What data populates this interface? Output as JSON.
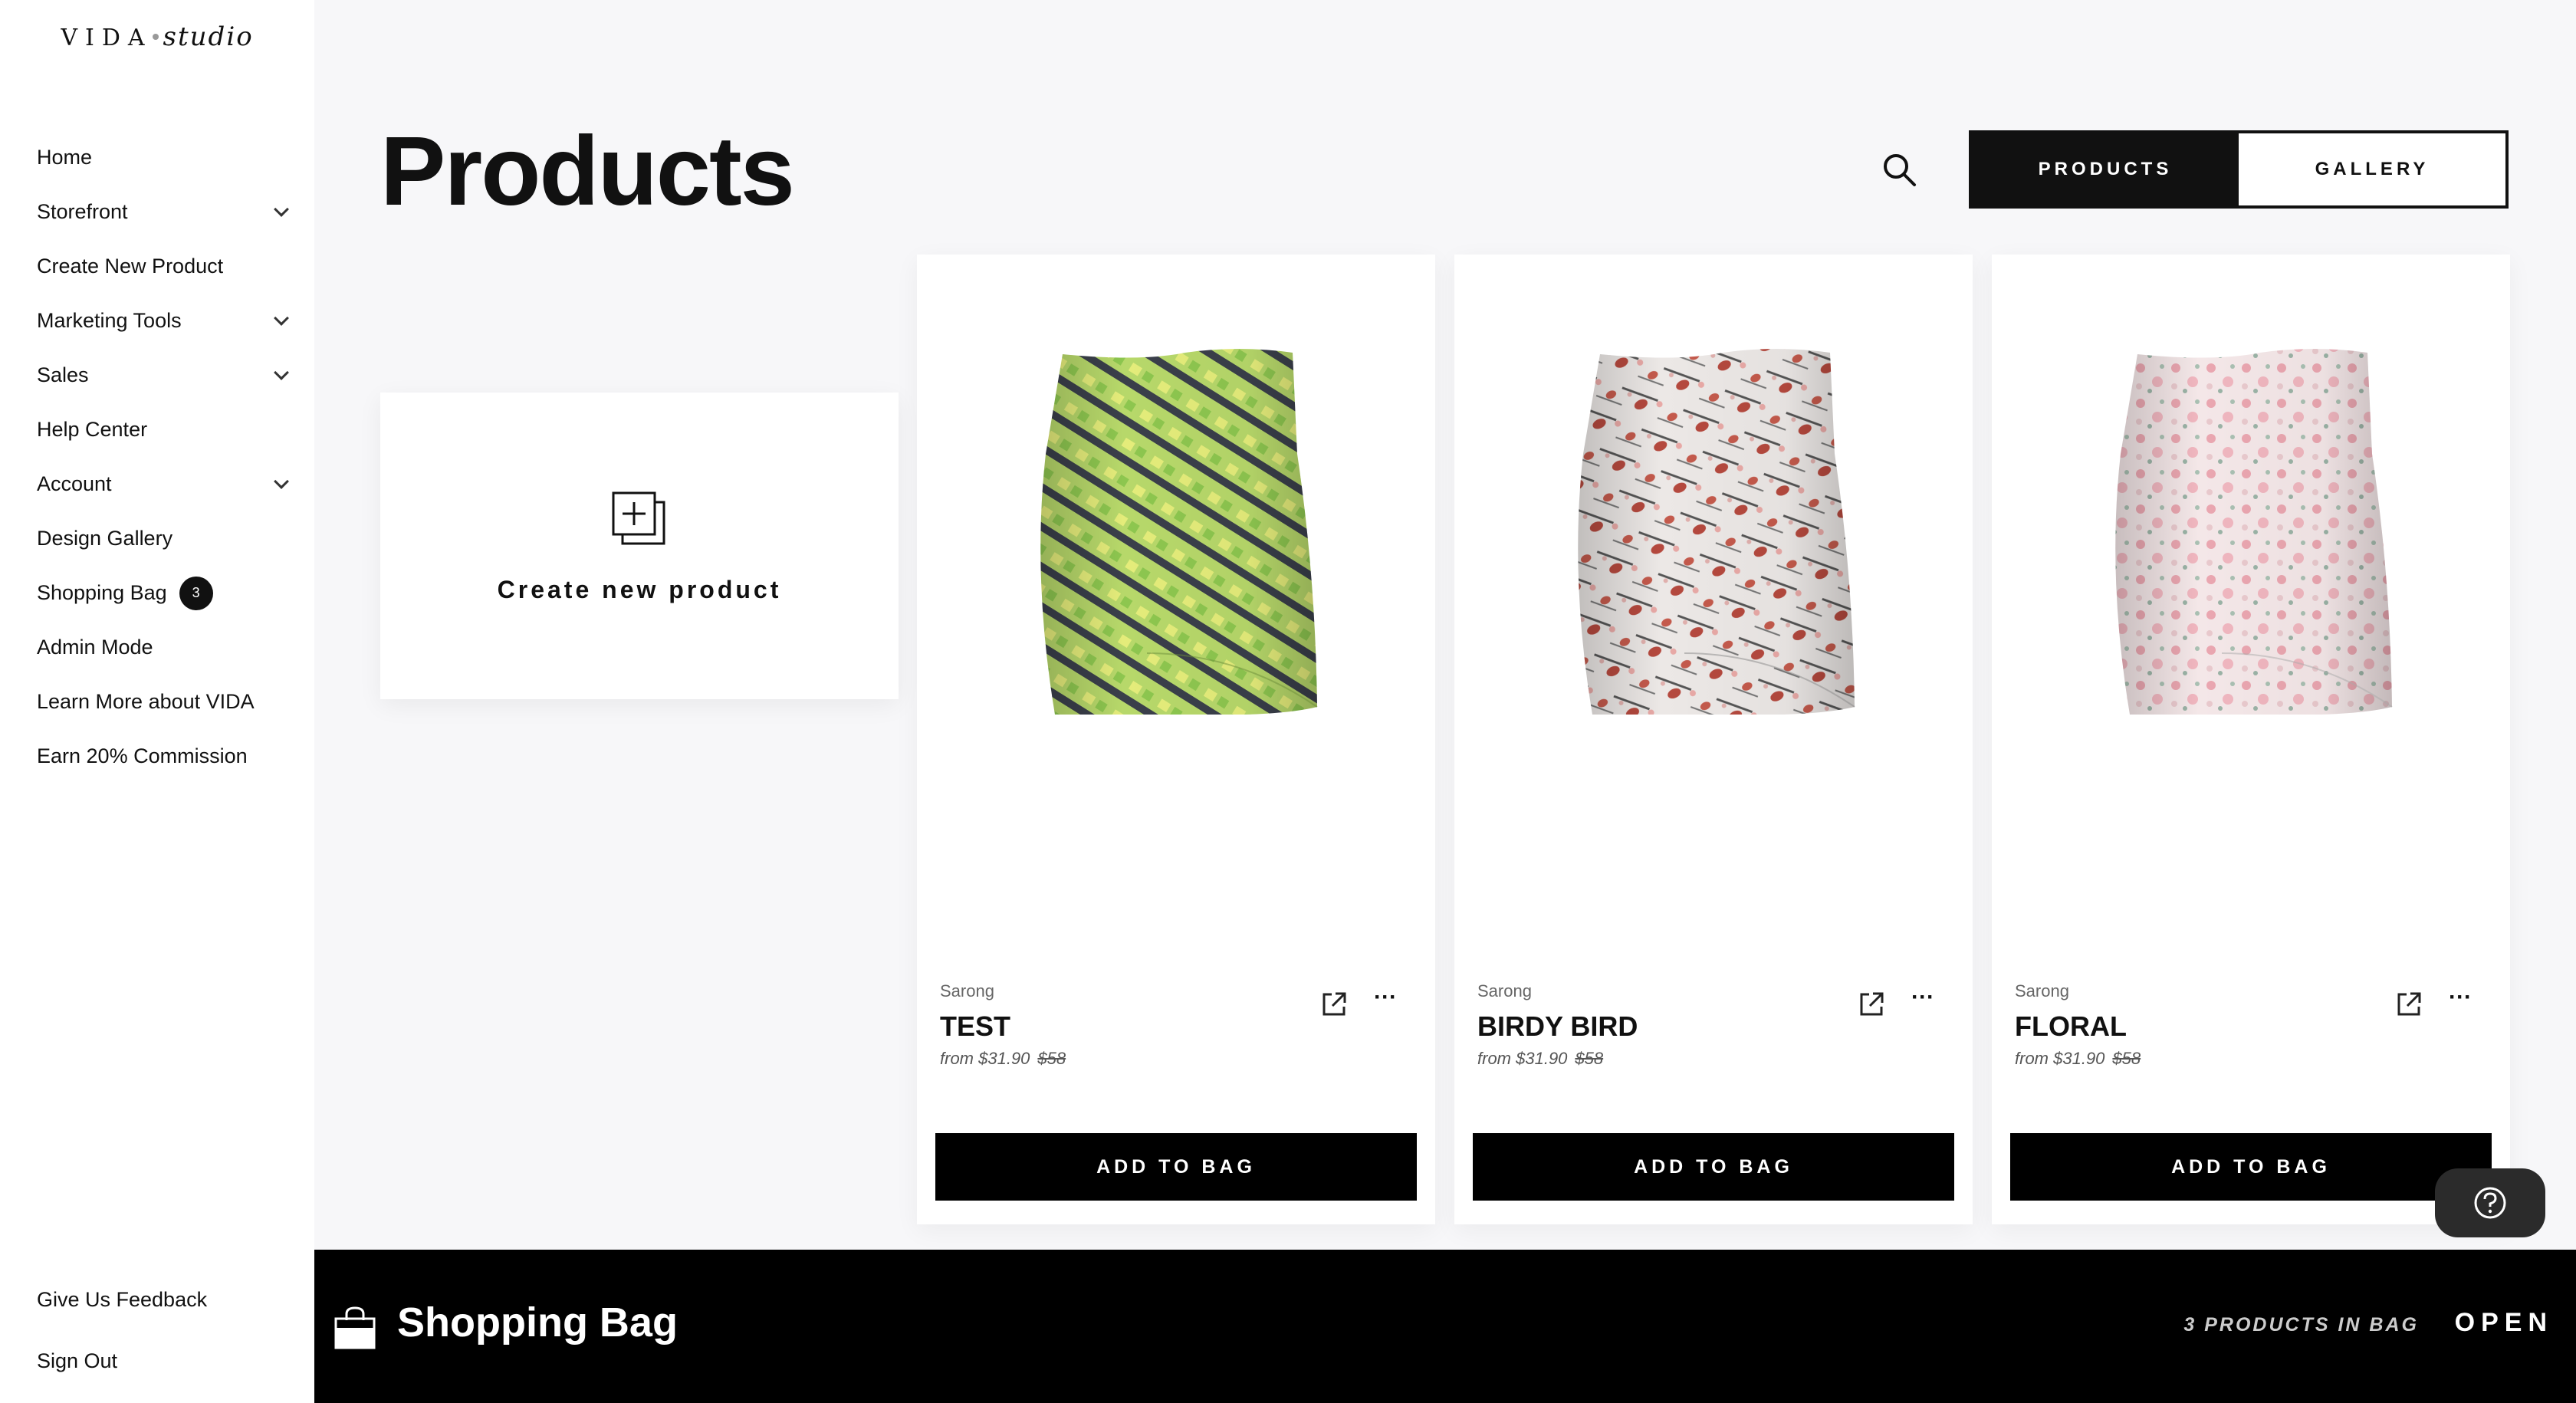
{
  "brand": {
    "left": "VIDA",
    "right": "studio"
  },
  "sidebar": {
    "items": [
      {
        "label": "Home",
        "expandable": false
      },
      {
        "label": "Storefront",
        "expandable": true
      },
      {
        "label": "Create New Product",
        "expandable": false
      },
      {
        "label": "Marketing Tools",
        "expandable": true
      },
      {
        "label": "Sales",
        "expandable": true
      },
      {
        "label": "Help Center",
        "expandable": false
      },
      {
        "label": "Account",
        "expandable": true
      },
      {
        "label": "Design Gallery",
        "expandable": false
      },
      {
        "label": "Shopping Bag",
        "badge": "3"
      },
      {
        "label": "Admin Mode",
        "expandable": false
      },
      {
        "label": "Learn More about VIDA",
        "expandable": false
      },
      {
        "label": "Earn 20% Commission",
        "expandable": false
      }
    ],
    "bottom": [
      {
        "label": "Give Us Feedback"
      },
      {
        "label": "Sign Out"
      }
    ]
  },
  "header": {
    "title": "Products",
    "tabs": [
      {
        "label": "PRODUCTS",
        "active": true
      },
      {
        "label": "GALLERY",
        "active": false
      }
    ]
  },
  "create_card": {
    "label": "Create new product"
  },
  "products": [
    {
      "type": "Sarong",
      "name": "TEST",
      "price_prefix": "from",
      "price": "$31.90",
      "old_price": "$58",
      "button": "ADD TO BAG",
      "pattern": "stripes"
    },
    {
      "type": "Sarong",
      "name": "BIRDY BIRD",
      "price_prefix": "from",
      "price": "$31.90",
      "old_price": "$58",
      "button": "ADD TO BAG",
      "pattern": "birds"
    },
    {
      "type": "Sarong",
      "name": "FLORAL",
      "price_prefix": "from",
      "price": "$31.90",
      "old_price": "$58",
      "button": "ADD TO BAG",
      "pattern": "floral"
    }
  ],
  "bag_bar": {
    "title": "Shopping Bag",
    "count_text": "3 PRODUCTS IN BAG",
    "open_label": "OPEN"
  },
  "colors": {
    "accent": "#000000",
    "background": "#f7f7f9",
    "card": "#ffffff"
  }
}
